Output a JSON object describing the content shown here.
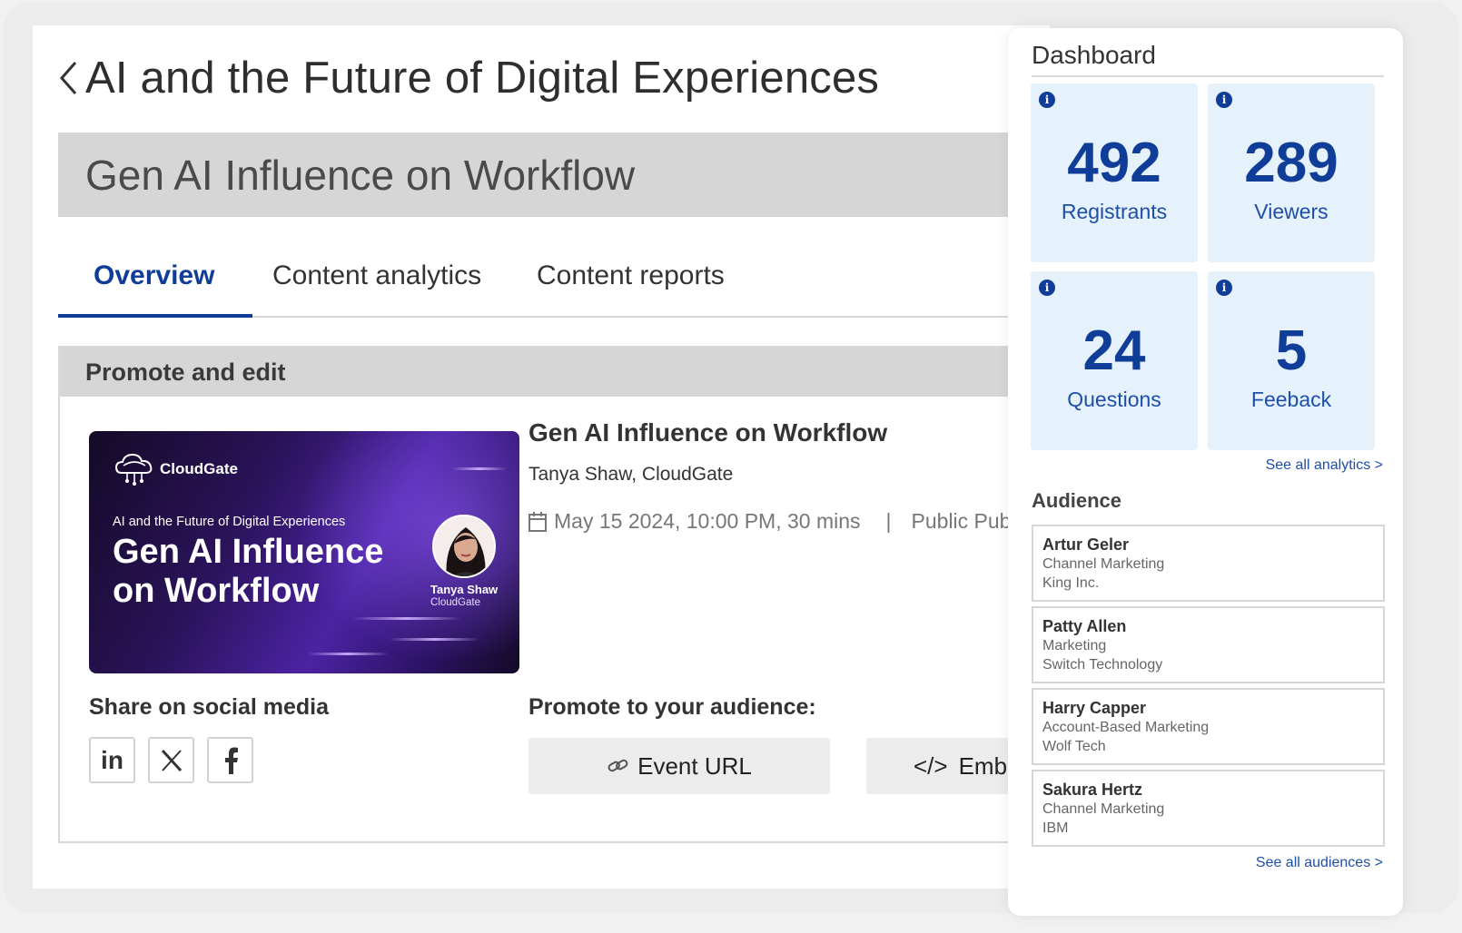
{
  "page": {
    "title": "AI and the Future of Digital Experiences"
  },
  "session": {
    "title": "Gen AI Influence on Workflow"
  },
  "tabs": [
    {
      "label": "Overview",
      "active": true
    },
    {
      "label": "Content analytics",
      "active": false
    },
    {
      "label": "Content reports",
      "active": false
    }
  ],
  "promote": {
    "header": "Promote and edit",
    "thumbnail": {
      "brand": "CloudGate",
      "subtitle": "AI and the Future of Digital Experiences",
      "headline": "Gen AI Influence on Workflow",
      "speaker_name": "Tanya Shaw",
      "speaker_org": "CloudGate"
    },
    "event_title": "Gen AI Influence on Workflow",
    "speaker": "Tanya Shaw, CloudGate",
    "datetime": "May 15 2024, 10:00 PM, 30 mins",
    "separator": "|",
    "visibility": "Public Published",
    "share_label": "Share on social media",
    "social": [
      {
        "icon": "linkedin-icon"
      },
      {
        "icon": "x-icon"
      },
      {
        "icon": "facebook-icon"
      }
    ],
    "promote_label": "Promote to your audience:",
    "event_url_label": "Event URL",
    "embed_label": "Embed"
  },
  "dashboard": {
    "title": "Dashboard",
    "stats": [
      {
        "value": "492",
        "label": "Registrants"
      },
      {
        "value": "289",
        "label": "Viewers"
      },
      {
        "value": "24",
        "label": "Questions"
      },
      {
        "value": "5",
        "label": "Feeback"
      }
    ],
    "see_all_analytics": "See all analytics  >",
    "audience_title": "Audience",
    "audience": [
      {
        "name": "Artur Geler",
        "role": "Channel Marketing",
        "company": "King Inc."
      },
      {
        "name": "Patty Allen",
        "role": "Marketing",
        "company": "Switch Technology"
      },
      {
        "name": "Harry Capper",
        "role": "Account-Based Marketing",
        "company": "Wolf Tech"
      },
      {
        "name": "Sakura Hertz",
        "role": "Channel Marketing",
        "company": "IBM"
      }
    ],
    "see_all_audiences": "See all audiences  >"
  },
  "colors": {
    "accent": "#0f3d98",
    "stat_bg": "#e5f1fb",
    "header_bg": "#d6d6d6"
  }
}
